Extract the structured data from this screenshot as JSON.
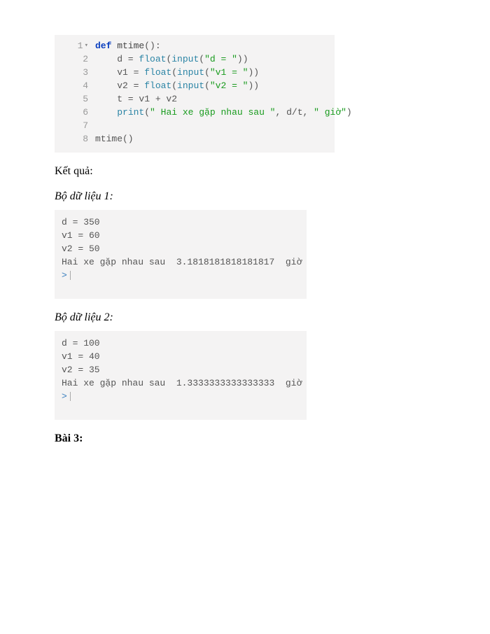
{
  "code": {
    "lines": [
      {
        "n": "1",
        "fold": true
      },
      {
        "n": "2"
      },
      {
        "n": "3"
      },
      {
        "n": "4"
      },
      {
        "n": "5"
      },
      {
        "n": "6"
      },
      {
        "n": "7"
      },
      {
        "n": "8"
      }
    ],
    "l1_kw": "def",
    "l1_name": " mtime",
    "l1_paren_open": "(",
    "l1_paren_close": ")",
    "l1_colon": ":",
    "l2_pre": "    d = ",
    "l2_fn": "float",
    "l2_open": "(",
    "l2_inner_fn": "input",
    "l2_inner_open": "(",
    "l2_str": "\"d = \"",
    "l2_close": "))",
    "l3_pre": "    v1 = ",
    "l3_fn": "float",
    "l3_open": "(",
    "l3_inner_fn": "input",
    "l3_inner_open": "(",
    "l3_str": "\"v1 = \"",
    "l3_close": "))",
    "l4_pre": "    v2 = ",
    "l4_fn": "float",
    "l4_open": "(",
    "l4_inner_fn": "input",
    "l4_inner_open": "(",
    "l4_str": "\"v2 = \"",
    "l4_close": "))",
    "l5": "    t = v1 + v2",
    "l6_pre": "    ",
    "l6_fn": "print",
    "l6_open": "(",
    "l6_str1": "\" Hai xe gặp nhau sau \"",
    "l6_mid": ", d/t, ",
    "l6_str2": "\" giờ\"",
    "l6_close": ")",
    "l7": "",
    "l8": "mtime()"
  },
  "labels": {
    "result": "Kết quả:",
    "dataset1": "Bộ dữ liệu 1:",
    "dataset2": "Bộ dữ liệu 2:",
    "bai3": "Bài 3:"
  },
  "output1": {
    "l1": "d = 350",
    "l2": "v1 = 60",
    "l3": "v2 = 50",
    "l4": "Hai xe gặp nhau sau  3.1818181818181817  giờ",
    "prompt": ">"
  },
  "output2": {
    "l1": "d = 100",
    "l2": "v1 = 40",
    "l3": "v2 = 35",
    "l4": "Hai xe gặp nhau sau  1.3333333333333333  giờ",
    "prompt": ">"
  }
}
